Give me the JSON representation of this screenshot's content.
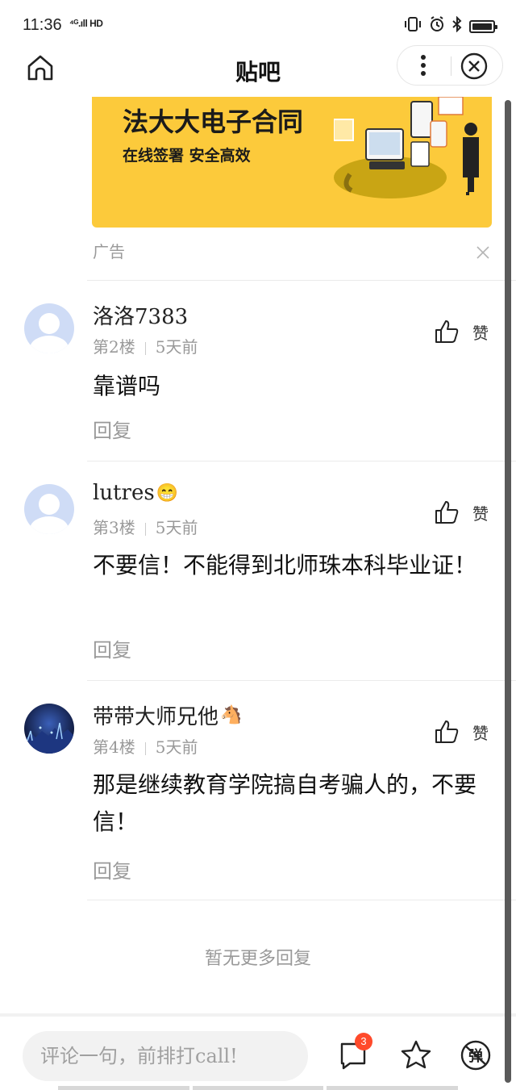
{
  "status_bar": {
    "time": "11:36",
    "network": "⁴ᴳ.ıll HD"
  },
  "nav": {
    "title": "贴吧"
  },
  "ad": {
    "title": "法大大电子合同",
    "subtitle": "在线签署  安全高效",
    "label": "广告"
  },
  "posts": [
    {
      "author": "洛洛7383",
      "emoji": "",
      "floor": "第2楼",
      "time": "5天前",
      "content": "靠谱吗",
      "reply_label": "回复",
      "like_label": "赞",
      "avatar": "default-avatar"
    },
    {
      "author": "lutres",
      "emoji": "😁",
      "floor": "第3楼",
      "time": "5天前",
      "content": "不要信！不能得到北师珠本科毕业证！",
      "reply_label": "回复",
      "like_label": "赞",
      "avatar": "default-avatar"
    },
    {
      "author": "带带大师兄他",
      "emoji": "🐴",
      "floor": "第4楼",
      "time": "5天前",
      "content": "那是继续教育学院搞自考骗人的，不要信！",
      "reply_label": "回复",
      "like_label": "赞",
      "avatar": "night-scene-avatar"
    }
  ],
  "footer_note": "暂无更多回复",
  "bottom_bar": {
    "comment_placeholder": "评论一句，前排打call!",
    "comment_badge": "3",
    "danmaku_label": "弹"
  },
  "colors": {
    "ad_background": "#fcca3b",
    "badge": "#ff4a2b",
    "muted_text": "#999999"
  }
}
